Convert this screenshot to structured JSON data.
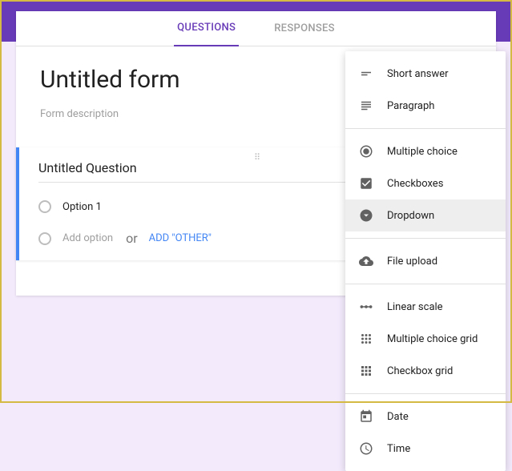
{
  "tabs": {
    "questions": "QUESTIONS",
    "responses": "RESPONSES"
  },
  "form": {
    "title": "Untitled form",
    "description": "Form description"
  },
  "question": {
    "title": "Untitled Question",
    "option1": "Option 1",
    "addOption": "Add option",
    "or": "or",
    "addOther": "ADD \"OTHER\""
  },
  "menu": {
    "shortAnswer": "Short answer",
    "paragraph": "Paragraph",
    "multipleChoice": "Multiple choice",
    "checkboxes": "Checkboxes",
    "dropdown": "Dropdown",
    "fileUpload": "File upload",
    "linearScale": "Linear scale",
    "mcGrid": "Multiple choice grid",
    "cbGrid": "Checkbox grid",
    "date": "Date",
    "time": "Time"
  }
}
